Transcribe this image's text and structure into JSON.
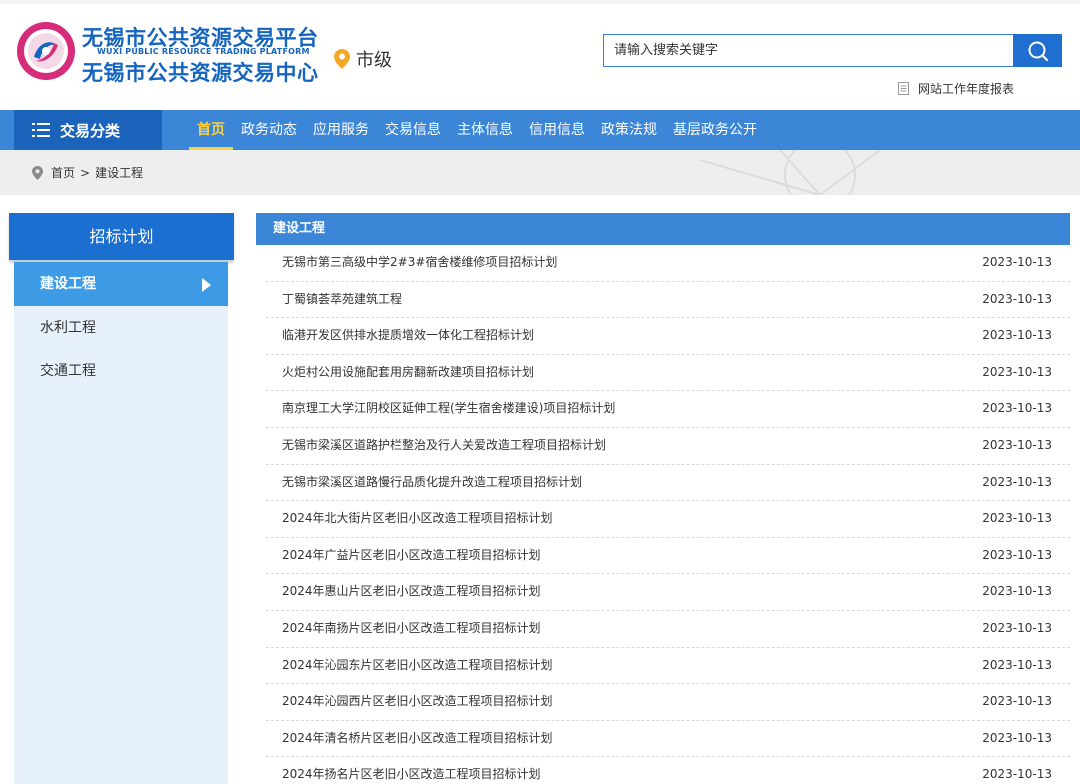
{
  "header": {
    "logo_title_1": "无锡市公共资源交易平台",
    "logo_title_en": "WUXI PUBLIC RESOURCE TRADING PLATFORM",
    "logo_title_2": "无锡市公共资源交易中心",
    "city_label": "市级",
    "search_placeholder": "请输入搜索关键字",
    "report_link": "网站工作年度报表"
  },
  "colors": {
    "brand_blue": "#1565c0",
    "nav_blue": "#3c86d8",
    "nav_dark": "#1b62ba",
    "active_yellow": "#ffd23a",
    "sidebar_active": "#3d9be5",
    "pin_orange": "#f5a623"
  },
  "nav": {
    "category_label": "交易分类",
    "items": [
      {
        "label": "首页",
        "active": true
      },
      {
        "label": "政务动态"
      },
      {
        "label": "应用服务"
      },
      {
        "label": "交易信息"
      },
      {
        "label": "主体信息"
      },
      {
        "label": "信用信息"
      },
      {
        "label": "政策法规"
      },
      {
        "label": "基层政务公开"
      }
    ]
  },
  "breadcrumb": {
    "home": "首页",
    "separator": ">",
    "current": "建设工程"
  },
  "sidebar": {
    "heading": "招标计划",
    "items": [
      {
        "label": "建设工程",
        "active": true
      },
      {
        "label": "水利工程"
      },
      {
        "label": "交通工程"
      }
    ]
  },
  "list": {
    "heading": "建设工程",
    "rows": [
      {
        "title": "无锡市第三高级中学2#3#宿舍楼维修项目招标计划",
        "date": "2023-10-13"
      },
      {
        "title": "丁蜀镇荟萃苑建筑工程",
        "date": "2023-10-13"
      },
      {
        "title": "临港开发区供排水提质增效一体化工程招标计划",
        "date": "2023-10-13"
      },
      {
        "title": "火炬村公用设施配套用房翻新改建项目招标计划",
        "date": "2023-10-13"
      },
      {
        "title": "南京理工大学江阴校区延伸工程(学生宿舍楼建设)项目招标计划",
        "date": "2023-10-13"
      },
      {
        "title": "无锡市梁溪区道路护栏整治及行人关爱改造工程项目招标计划",
        "date": "2023-10-13"
      },
      {
        "title": "无锡市梁溪区道路慢行品质化提升改造工程项目招标计划",
        "date": "2023-10-13"
      },
      {
        "title": "2024年北大街片区老旧小区改造工程项目招标计划",
        "date": "2023-10-13"
      },
      {
        "title": "2024年广益片区老旧小区改造工程项目招标计划",
        "date": "2023-10-13"
      },
      {
        "title": "2024年惠山片区老旧小区改造工程项目招标计划",
        "date": "2023-10-13"
      },
      {
        "title": "2024年南扬片区老旧小区改造工程项目招标计划",
        "date": "2023-10-13"
      },
      {
        "title": "2024年沁园东片区老旧小区改造工程项目招标计划",
        "date": "2023-10-13"
      },
      {
        "title": "2024年沁园西片区老旧小区改造工程项目招标计划",
        "date": "2023-10-13"
      },
      {
        "title": "2024年清名桥片区老旧小区改造工程项目招标计划",
        "date": "2023-10-13"
      },
      {
        "title": "2024年扬名片区老旧小区改造工程项目招标计划",
        "date": "2023-10-13"
      }
    ]
  }
}
